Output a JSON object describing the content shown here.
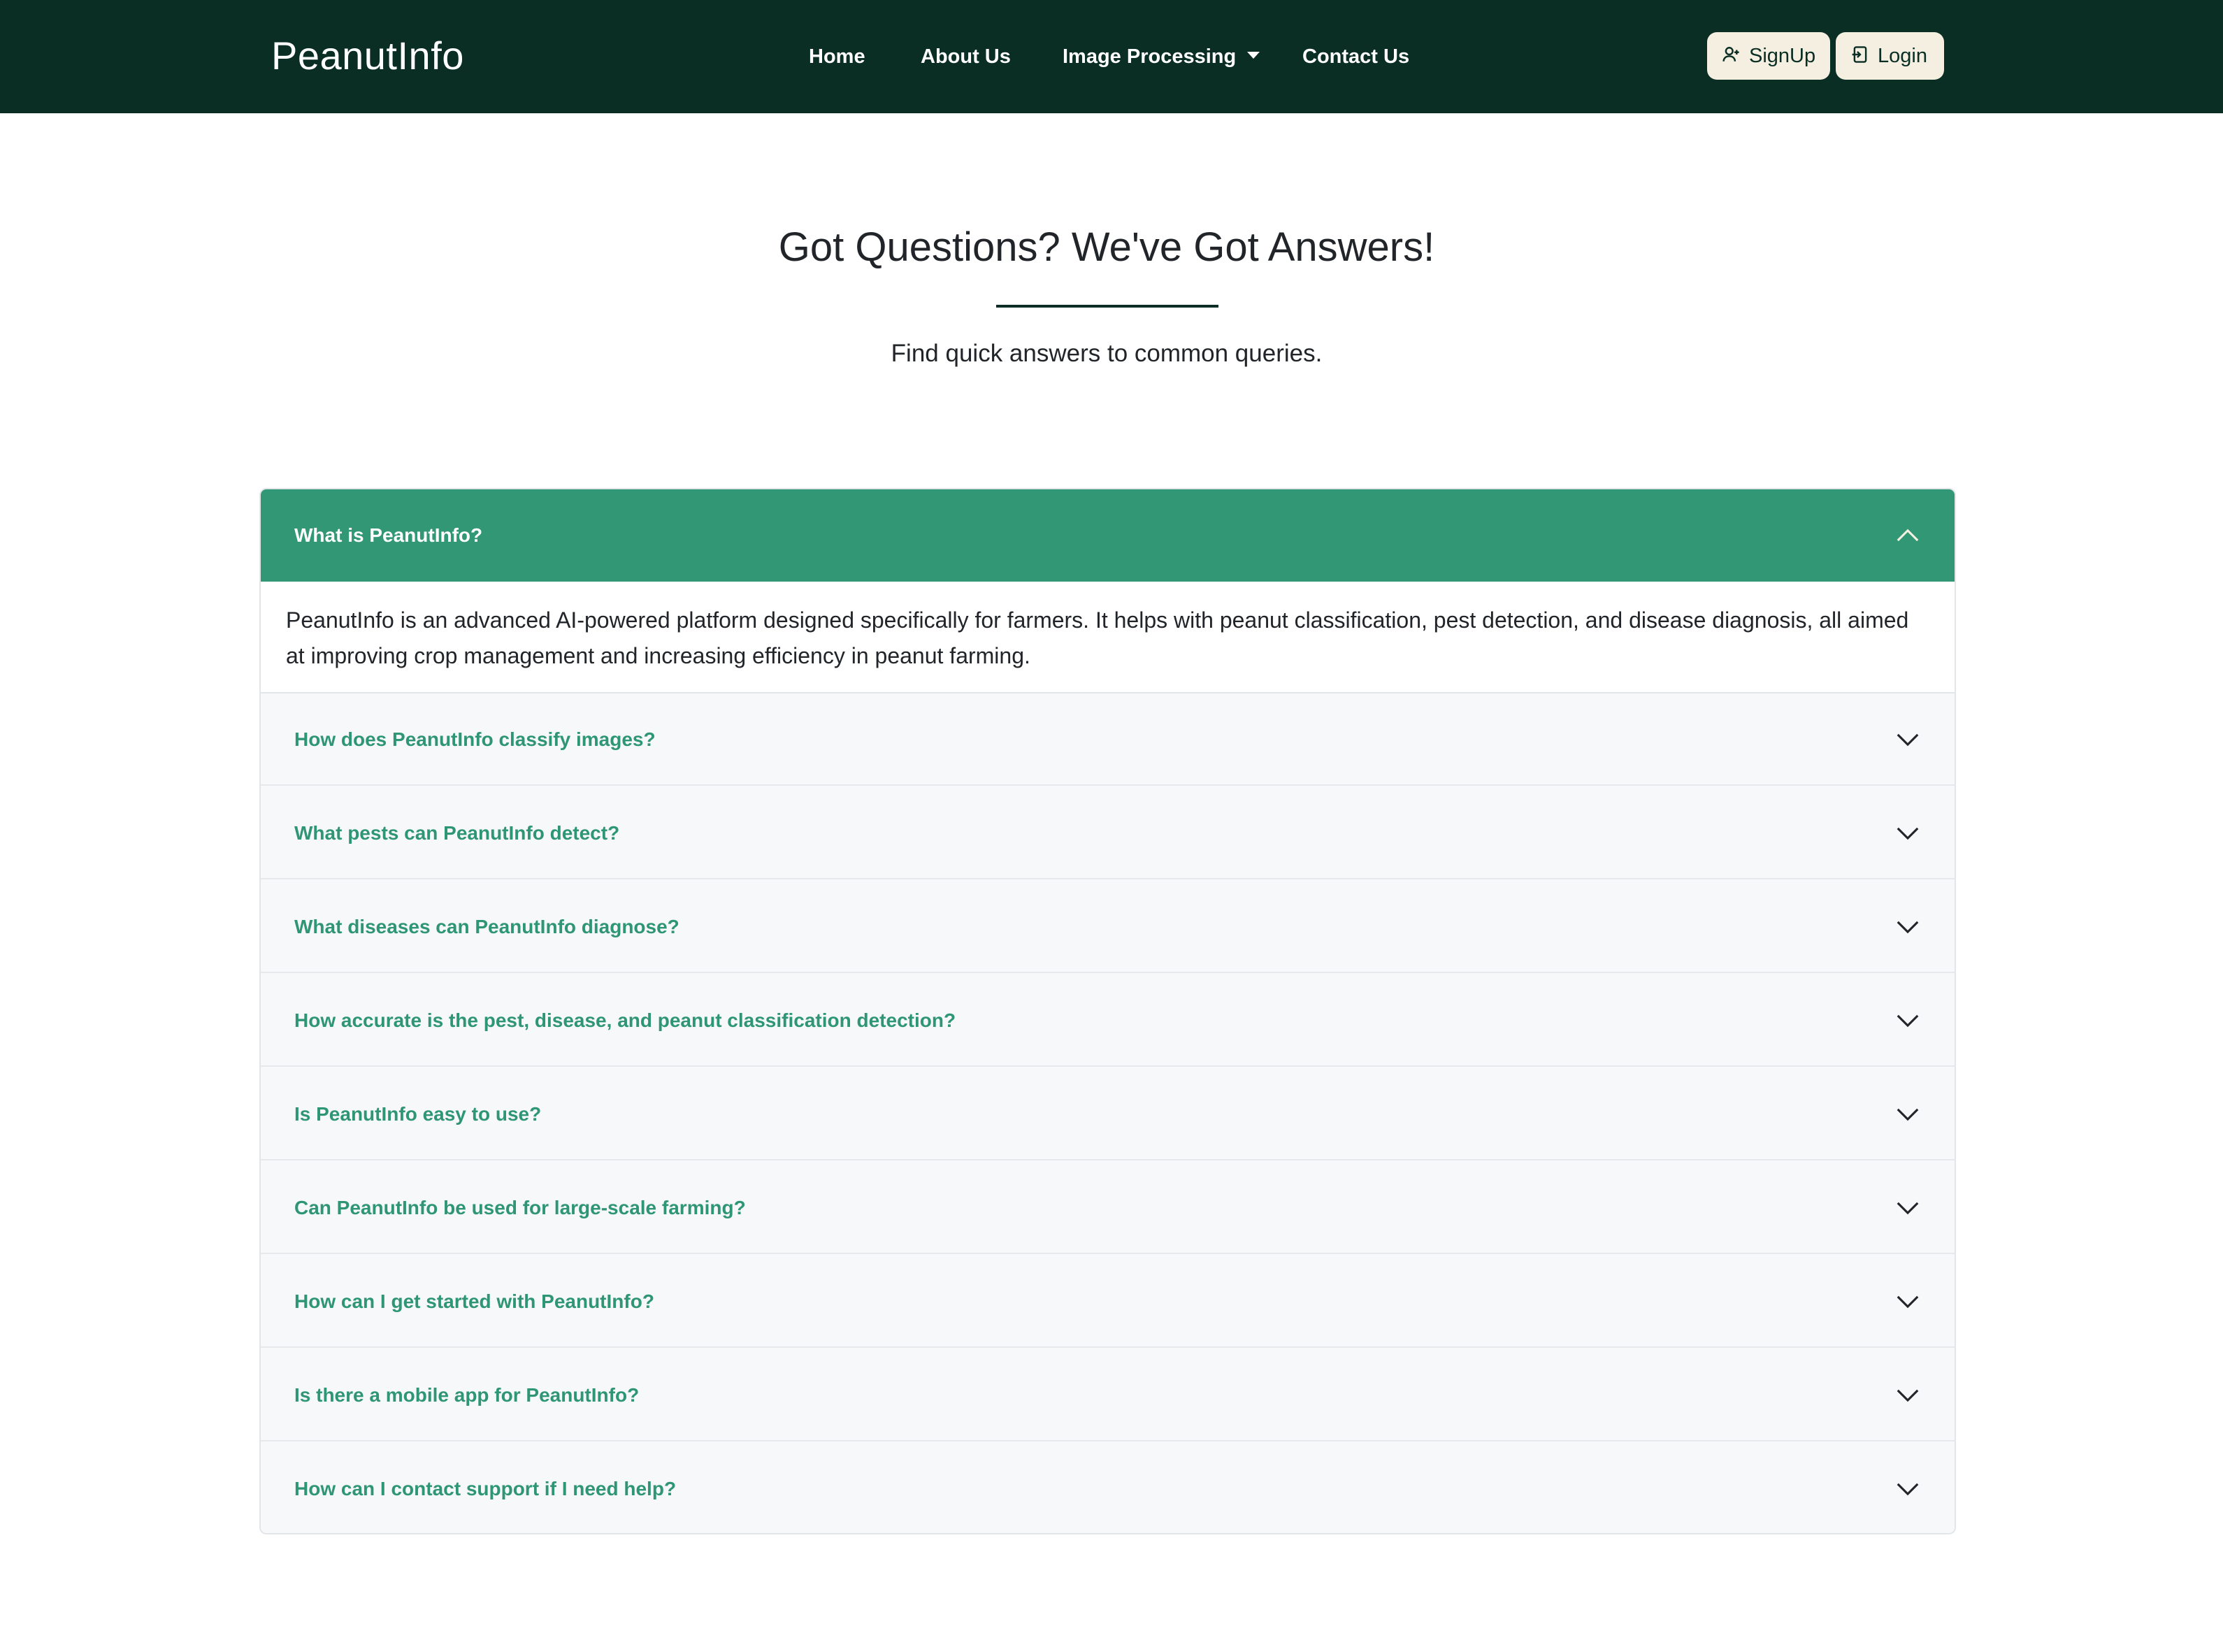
{
  "navbar": {
    "brand": "PeanutInfo",
    "links": [
      {
        "label": "Home"
      },
      {
        "label": "About Us"
      },
      {
        "label": "Image Processing"
      },
      {
        "label": "Contact Us"
      }
    ],
    "signup_label": "SignUp",
    "login_label": "Login",
    "signup_icon": "person-add-icon",
    "login_icon": "login-icon"
  },
  "hero": {
    "title": "Got Questions? We've Got Answers!",
    "subtitle": "Find quick answers to common queries."
  },
  "faq": {
    "open_question": "What is PeanutInfo?",
    "open_answer": "PeanutInfo is an advanced AI-powered platform designed specifically for farmers. It helps with peanut classification, pest detection, and disease diagnosis, all aimed at improving crop management and increasing efficiency in peanut farming.",
    "questions": [
      "How does PeanutInfo classify images?",
      "What pests can PeanutInfo detect?",
      "What diseases can PeanutInfo diagnose?",
      "How accurate is the pest, disease, and peanut classification detection?",
      "Is PeanutInfo easy to use?",
      "Can PeanutInfo be used for large-scale farming?",
      "How can I get started with PeanutInfo?",
      "Is there a mobile app for PeanutInfo?",
      "How can I contact support if I need help?"
    ]
  },
  "colors": {
    "navbar_bg": "#0a2e24",
    "accent_green": "#319774",
    "button_bg": "#f5efe2"
  }
}
